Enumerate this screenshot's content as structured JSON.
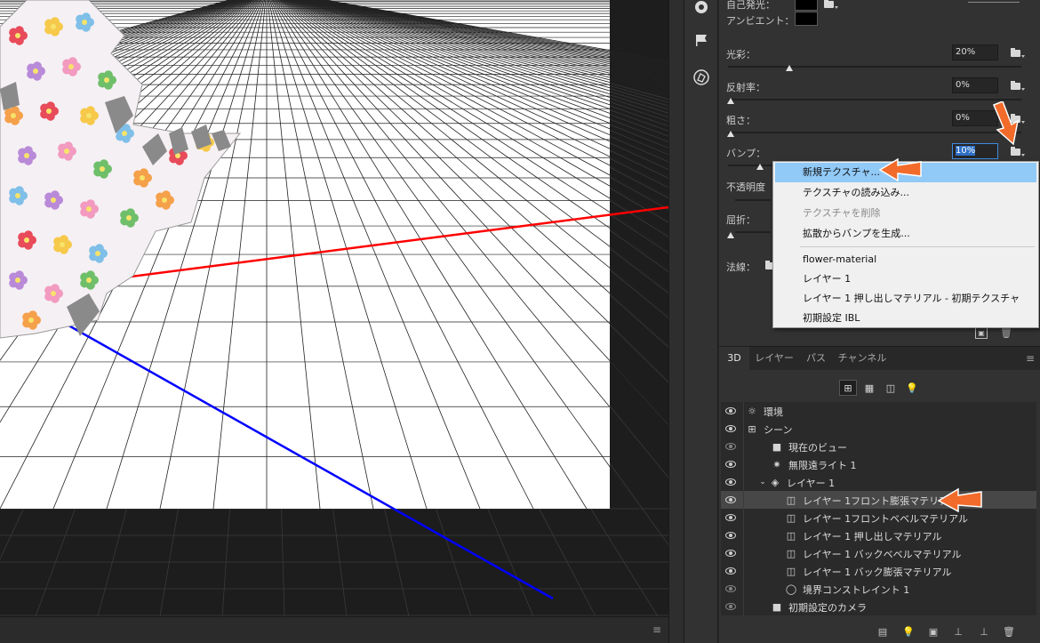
{
  "properties": {
    "self_illumination_label": "自己発光：",
    "ambient_label": "アンビエント：",
    "rows": [
      {
        "label": "光彩：",
        "value": "20%",
        "level": 0.2
      },
      {
        "label": "反射率：",
        "value": "0%",
        "level": 0.0
      },
      {
        "label": "粗さ：",
        "value": "0%",
        "level": 0.0
      },
      {
        "label": "バンプ：",
        "value": "10%",
        "level": 0.1
      }
    ],
    "opacity_label": "不透明度",
    "refraction_label": "屈折：",
    "normal_label": "法線："
  },
  "context_menu": {
    "items": [
      {
        "label": "新規テクスチャ...",
        "state": "highlighted"
      },
      {
        "label": "テクスチャの読み込み...",
        "state": "normal"
      },
      {
        "label": "テクスチャを削除",
        "state": "disabled"
      },
      {
        "label": "拡散からバンプを生成...",
        "state": "normal"
      }
    ],
    "textures": [
      {
        "label": "flower-material"
      },
      {
        "label": "レイヤー 1"
      },
      {
        "label": "レイヤー 1 押し出しマテリアル - 初期テクスチャ"
      },
      {
        "label": "初期設定 IBL"
      }
    ]
  },
  "panel": {
    "tabs": [
      {
        "label": "3D",
        "active": true
      },
      {
        "label": "レイヤー",
        "active": false
      },
      {
        "label": "パス",
        "active": false
      },
      {
        "label": "チャンネル",
        "active": false
      }
    ],
    "tree": [
      {
        "label": "環境",
        "icon": "environment-icon",
        "glyph": "☼",
        "indent": 0,
        "visible": true
      },
      {
        "label": "シーン",
        "icon": "scene-icon",
        "glyph": "⊞",
        "indent": 0,
        "visible": true
      },
      {
        "label": "現在のビュー",
        "icon": "camera-icon",
        "glyph": "■",
        "indent": 1,
        "visible": false
      },
      {
        "label": "無限遠ライト 1",
        "icon": "light-icon",
        "glyph": "✷",
        "indent": 1,
        "visible": true
      },
      {
        "label": "レイヤー 1",
        "icon": "mesh-icon",
        "glyph": "◈",
        "indent": 1,
        "visible": true,
        "expanded": true
      },
      {
        "label": "レイヤー 1フロント膨張マテリアル",
        "icon": "material-icon",
        "glyph": "◫",
        "indent": 2,
        "visible": true,
        "selected": true
      },
      {
        "label": "レイヤー 1フロントベベルマテリアル",
        "icon": "material-icon",
        "glyph": "◫",
        "indent": 2,
        "visible": true
      },
      {
        "label": "レイヤー 1 押し出しマテリアル",
        "icon": "material-icon",
        "glyph": "◫",
        "indent": 2,
        "visible": true
      },
      {
        "label": "レイヤー 1 バックベベルマテリアル",
        "icon": "material-icon",
        "glyph": "◫",
        "indent": 2,
        "visible": true
      },
      {
        "label": "レイヤー 1 バック膨張マテリアル",
        "icon": "material-icon",
        "glyph": "◫",
        "indent": 2,
        "visible": true
      },
      {
        "label": "境界コンストレイント 1",
        "icon": "constraint-icon",
        "glyph": "◯",
        "indent": 2,
        "visible": false
      },
      {
        "label": "初期設定のカメラ",
        "icon": "camera-icon",
        "glyph": "■",
        "indent": 1,
        "visible": false
      }
    ]
  },
  "colors": {
    "accent_arrow": "#f26b2a",
    "menu_highlight": "#91c9f7",
    "x_axis": "#ff0000",
    "z_axis": "#0000ff"
  }
}
